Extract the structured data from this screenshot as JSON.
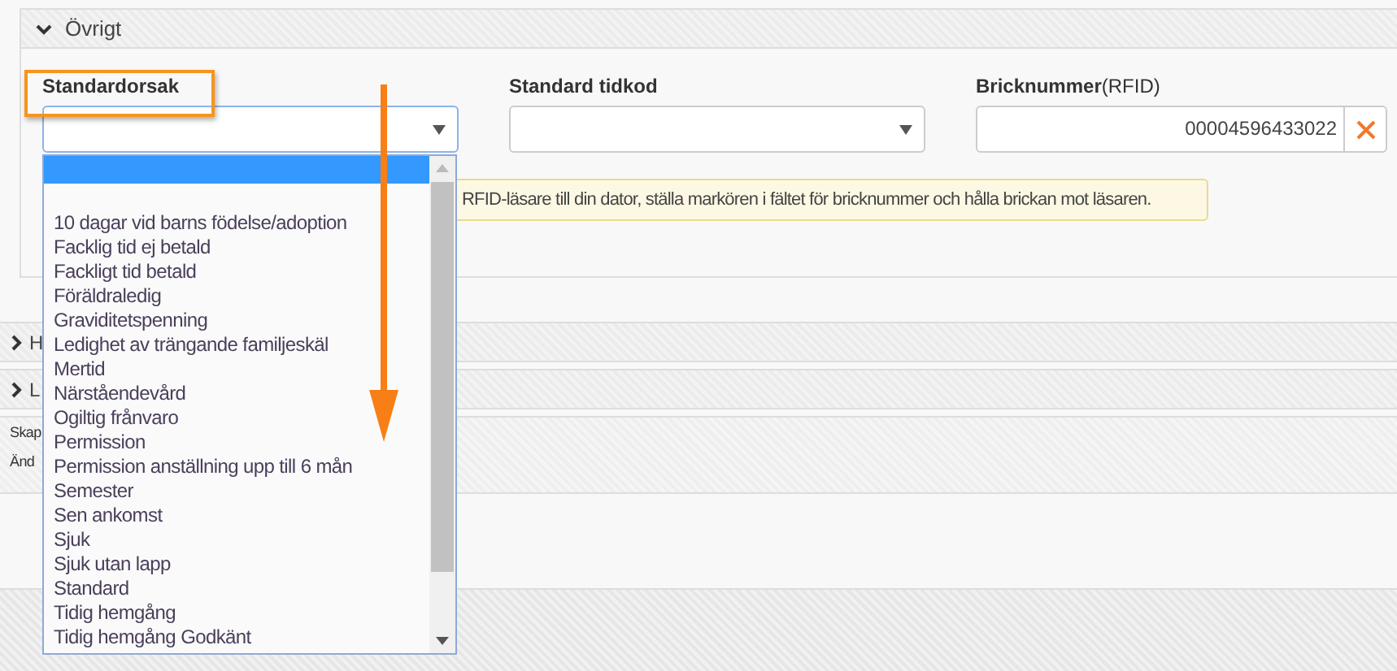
{
  "sections": [
    {
      "title": "Övrigt",
      "expanded": true
    },
    {
      "title": "H",
      "expanded": false
    },
    {
      "title": "L",
      "expanded": false
    }
  ],
  "fields": [
    {
      "kind": "select",
      "label": "Standardorsak",
      "focused": true
    },
    {
      "kind": "select",
      "label": "Standard tidkod",
      "focused": false
    },
    {
      "kind": "clearable",
      "label": "Bricknummer",
      "label_suffix": "(RFID)",
      "value": "00004596433022"
    }
  ],
  "info": "RFID-läsare till din dator, ställa markören i fältet för bricknummer och hålla brickan mot läsaren.",
  "meta_rows": [
    "Skap",
    "Änd"
  ],
  "dropdown": {
    "blank_options": [
      {
        "selected": true
      }
    ],
    "options": [
      {
        "label": "10 dagar vid barns födelse/adoption",
        "selected": false
      },
      {
        "label": "Facklig tid ej betald",
        "selected": false
      },
      {
        "label": "Fackligt tid betald",
        "selected": false
      },
      {
        "label": "Föräldraledig",
        "selected": false
      },
      {
        "label": "Graviditetspenning",
        "selected": false
      },
      {
        "label": "Ledighet av trängande familjeskäl",
        "selected": false
      },
      {
        "label": "Mertid",
        "selected": false
      },
      {
        "label": "Närståendevård",
        "selected": false
      },
      {
        "label": "Ogiltig frånvaro",
        "selected": false
      },
      {
        "label": "Permission",
        "selected": false
      },
      {
        "label": "Permission anställning upp till 6 mån",
        "selected": false
      },
      {
        "label": "Semester",
        "selected": false
      },
      {
        "label": "Sen ankomst",
        "selected": false
      },
      {
        "label": "Sjuk",
        "selected": false
      },
      {
        "label": "Sjuk utan lapp",
        "selected": false
      },
      {
        "label": "Standard",
        "selected": false
      },
      {
        "label": "Tidig hemgång",
        "selected": false
      },
      {
        "label": "Tidig hemgång Godkänt",
        "selected": false
      }
    ]
  }
}
